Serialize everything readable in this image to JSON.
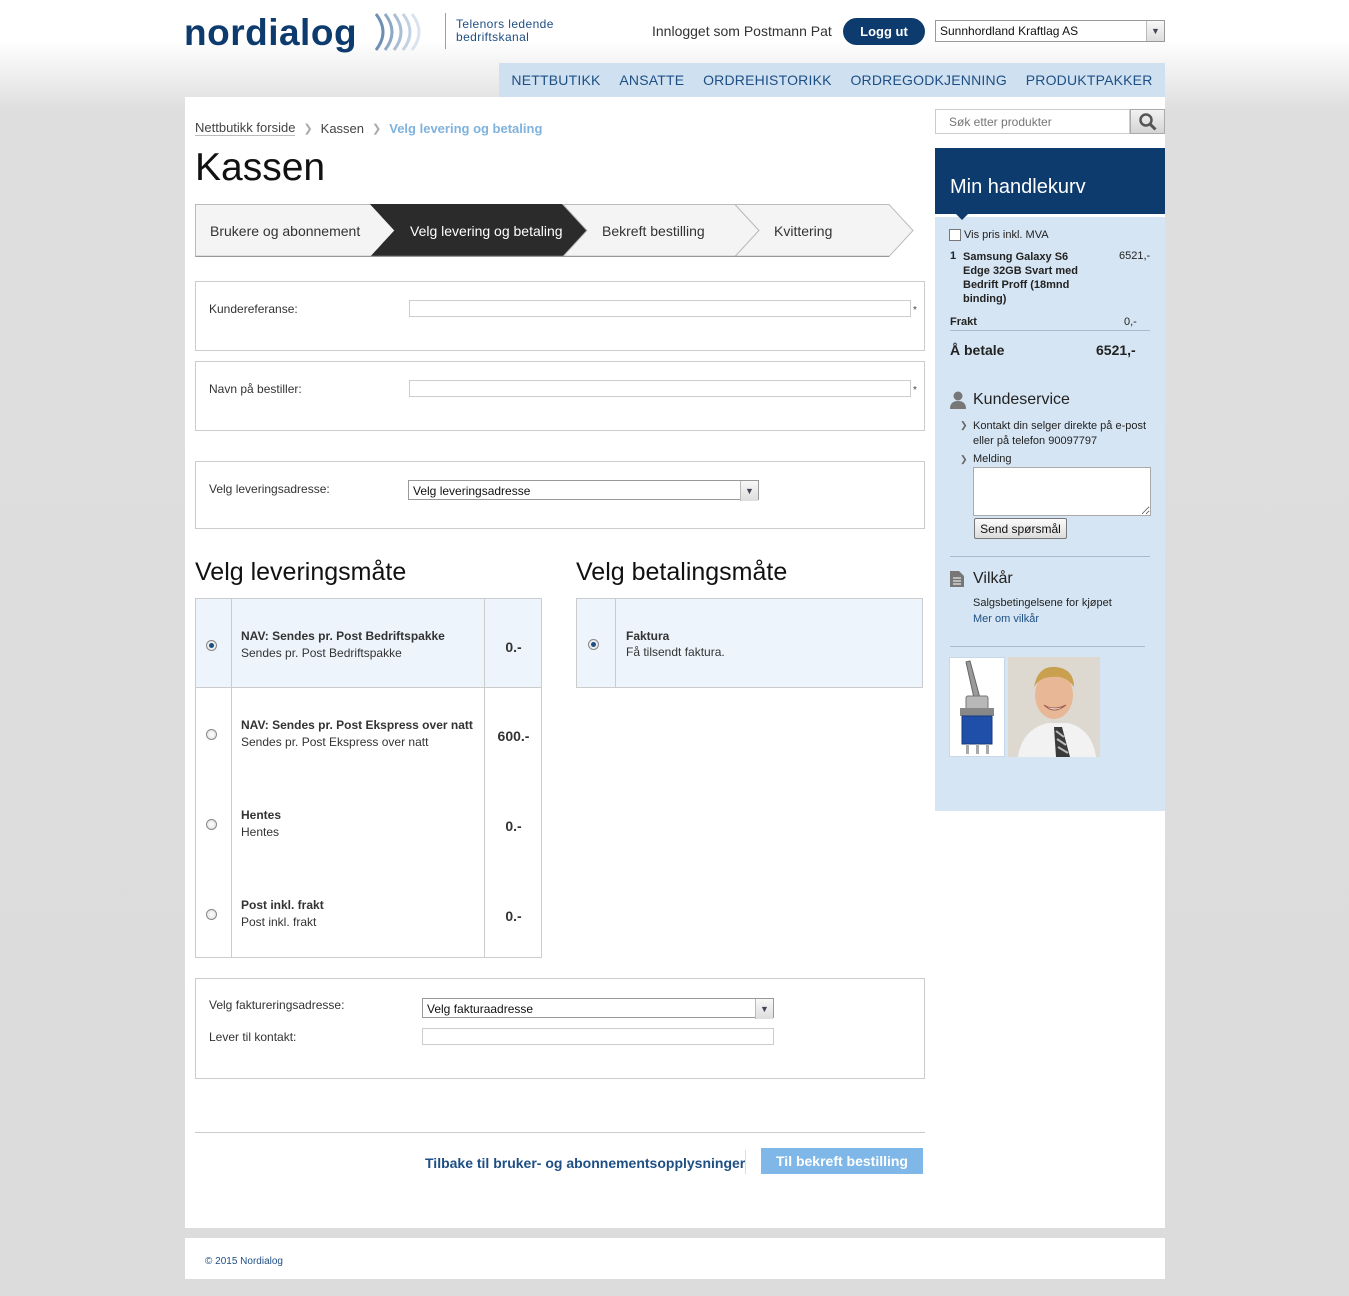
{
  "header": {
    "logo_text": "nordialog",
    "tagline_line1": "Telenors ledende",
    "tagline_line2": "bedriftskanal",
    "logged_in_text": "Innlogget som Postmann Pat",
    "logout_label": "Logg ut",
    "company_selected": "Sunnhordland Kraftlag AS"
  },
  "nav": {
    "items": [
      "NETTBUTIKK",
      "ANSATTE",
      "ORDREHISTORIKK",
      "ORDREGODKJENNING",
      "PRODUKTPAKKER"
    ]
  },
  "breadcrumb": {
    "items": [
      "Nettbutikk forside",
      "Kassen",
      "Velg levering og betaling"
    ]
  },
  "page_title": "Kassen",
  "steps": [
    {
      "label": "Brukere og abonnement",
      "active": false
    },
    {
      "label": "Velg levering og betaling",
      "active": true
    },
    {
      "label": "Bekreft bestilling",
      "active": false
    },
    {
      "label": "Kvittering",
      "active": false
    }
  ],
  "form": {
    "kundereferanse_label": "Kundereferanse:",
    "kundereferanse_value": "",
    "bestiller_label": "Navn på bestiller:",
    "bestiller_value": "",
    "required_mark": "*",
    "leveringsadresse_label": "Velg leveringsadresse:",
    "leveringsadresse_selected": "Velg leveringsadresse"
  },
  "delivery": {
    "heading": "Velg leveringsmåte",
    "options": [
      {
        "title": "NAV: Sendes pr. Post Bedriftspakke",
        "subtitle": "Sendes pr. Post Bedriftspakke",
        "price": "0.-",
        "selected": true
      },
      {
        "title": "NAV: Sendes pr. Post Ekspress over natt",
        "subtitle": "Sendes pr. Post Ekspress over natt",
        "price": "600.-",
        "selected": false
      },
      {
        "title": "Hentes",
        "subtitle": "Hentes",
        "price": "0.-",
        "selected": false
      },
      {
        "title": "Post inkl. frakt",
        "subtitle": "Post inkl. frakt",
        "price": "0.-",
        "selected": false
      }
    ]
  },
  "payment": {
    "heading": "Velg betalingsmåte",
    "options": [
      {
        "title": "Faktura",
        "subtitle": "Få tilsendt faktura.",
        "selected": true
      }
    ]
  },
  "billing": {
    "fakturaadresse_label": "Velg faktureringsadresse:",
    "fakturaadresse_selected": "Velg fakturaadresse",
    "kontakt_label": "Lever til kontakt:",
    "kontakt_value": ""
  },
  "actions": {
    "back_label": "Tilbake til bruker- og abonnementsopplysninger",
    "next_label": "Til bekreft bestilling"
  },
  "sidebar": {
    "search_placeholder": "Søk etter produkter",
    "cart_title": "Min handlekurv",
    "vis_pris_label": "Vis pris inkl. MVA",
    "cart_items": [
      {
        "qty": "1",
        "name_lines": [
          "Samsung Galaxy S6",
          "Edge 32GB Svart med",
          "Bedrift Proff (18mnd",
          "binding)"
        ],
        "price": "6521,-"
      }
    ],
    "frakt_label": "Frakt",
    "frakt_value": "0,-",
    "total_label": "Å betale",
    "total_value": "6521,-",
    "kundeservice_title": "Kundeservice",
    "kundeservice_text_1": "Kontakt din selger direkte på e-post",
    "kundeservice_text_2": "eller på telefon 90097797",
    "melding_label": "Melding",
    "melding_value": "",
    "send_label": "Send spørsmål",
    "vilkar_title": "Vilkår",
    "vilkar_text": "Salgsbetingelsene for kjøpet",
    "vilkar_link": "Mer om vilkår"
  },
  "footer": {
    "copyright": "© 2015 Nordialog"
  },
  "colors": {
    "brand_navy": "#0d3b6e",
    "nav_bg": "#cfe0f0",
    "sidebar_bg": "#d6e5f3",
    "accent_light_blue": "#7fb8e8",
    "active_step": "#2b2b2b"
  }
}
